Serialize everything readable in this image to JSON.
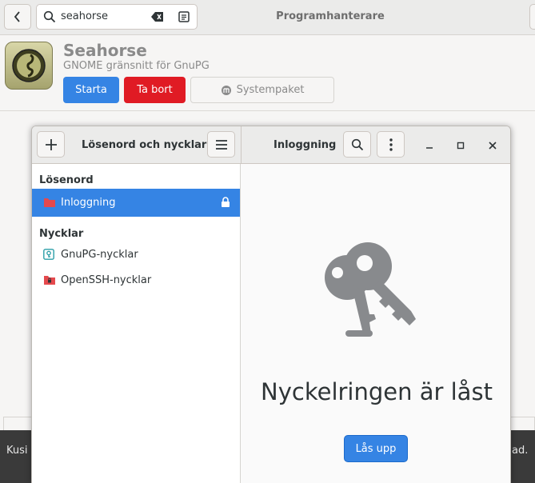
{
  "software": {
    "search": {
      "value": "seahorse"
    },
    "title": "Programhanterare",
    "app": {
      "name": "Seahorse",
      "description": "GNOME gränsnitt för GnuPG",
      "start_label": "Starta",
      "remove_label": "Ta bort",
      "system_package_label": "Systempaket"
    },
    "bottom_left_text": "Kusi",
    "bottom_right_text": "ad."
  },
  "seahorse": {
    "sidebar_title": "Lösenord och nycklar",
    "content_title": "Inloggning",
    "sections": {
      "passwords": {
        "heading": "Lösenord",
        "items": [
          {
            "label": "Inloggning"
          }
        ]
      },
      "keys": {
        "heading": "Nycklar",
        "items": [
          {
            "label": "GnuPG-nycklar"
          },
          {
            "label": "OpenSSH-nycklar"
          }
        ]
      }
    },
    "locked_message": "Nyckelringen är låst",
    "unlock_label": "Lås upp"
  },
  "colors": {
    "accent": "#3584e4",
    "destructive": "#e01b24",
    "folder": "#e5494d"
  }
}
